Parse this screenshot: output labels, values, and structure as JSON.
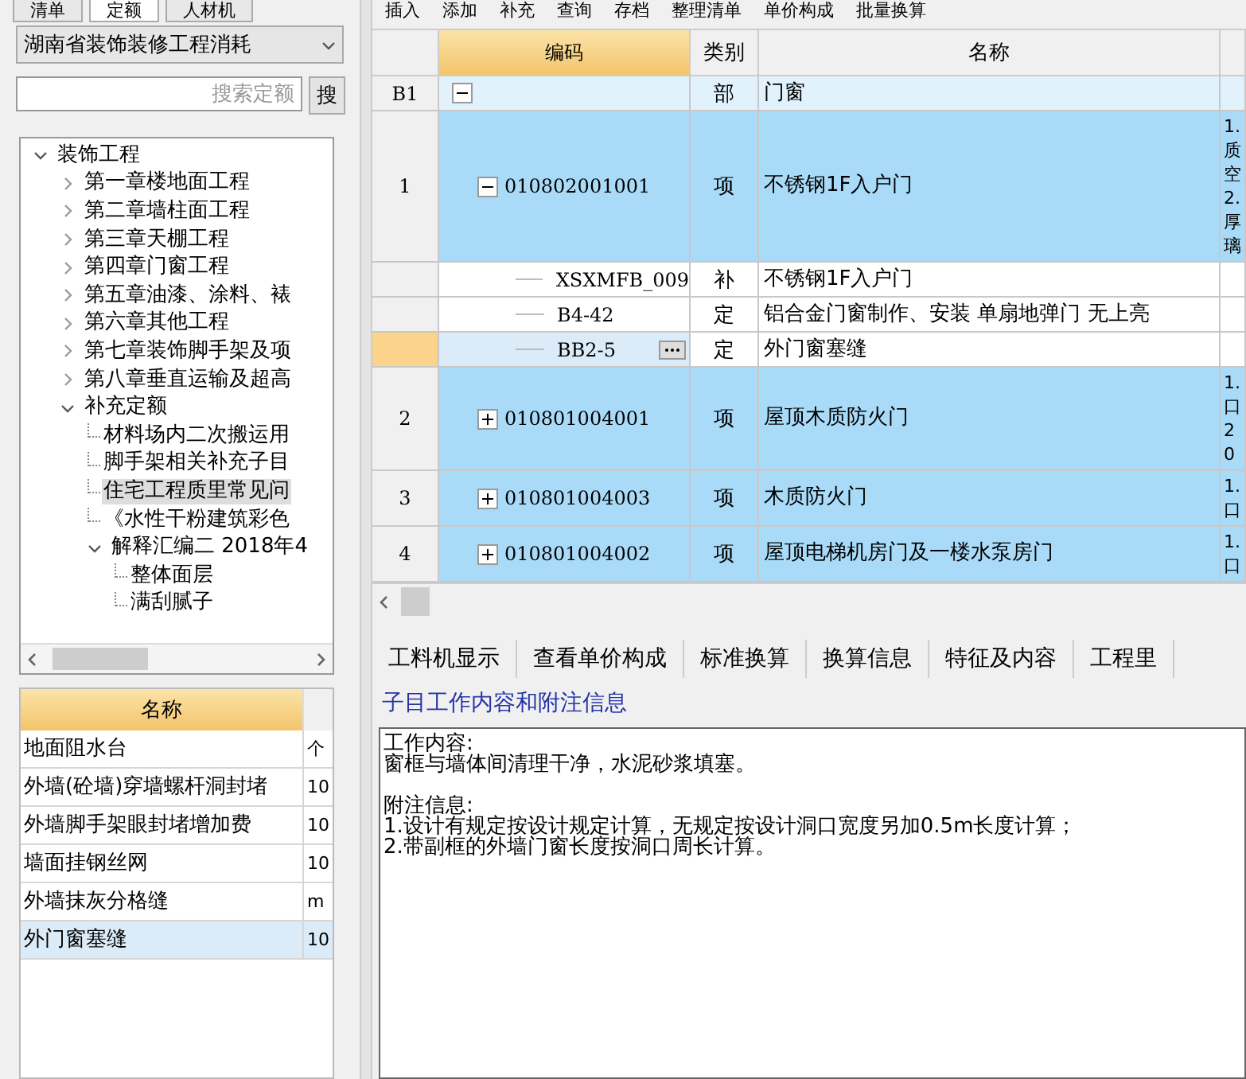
{
  "left_tabs": [
    {
      "label": "清单",
      "selected": false
    },
    {
      "label": "定额",
      "selected": true
    },
    {
      "label": "人材机",
      "selected": false
    }
  ],
  "library_dropdown": {
    "value": "湖南省装饰装修工程消耗"
  },
  "search": {
    "placeholder": "搜索定额",
    "button": "搜"
  },
  "tree": [
    {
      "label": "装饰工程",
      "expanded": true,
      "selected": false,
      "children": [
        {
          "label": "第一章楼地面工程",
          "expanded": false,
          "selected": false
        },
        {
          "label": "第二章墙柱面工程",
          "expanded": false,
          "selected": false
        },
        {
          "label": "第三章天棚工程",
          "expanded": false,
          "selected": false
        },
        {
          "label": "第四章门窗工程",
          "expanded": false,
          "selected": false
        },
        {
          "label": "第五章油漆、涂料、裱",
          "expanded": false,
          "selected": false
        },
        {
          "label": "第六章其他工程",
          "expanded": false,
          "selected": false
        },
        {
          "label": "第七章装饰脚手架及项",
          "expanded": false,
          "selected": false
        },
        {
          "label": "第八章垂直运输及超高",
          "expanded": false,
          "selected": false
        },
        {
          "label": "补充定额",
          "expanded": true,
          "selected": false,
          "children": [
            {
              "label": "材料场内二次搬运用",
              "selected": false
            },
            {
              "label": "脚手架相关补充子目",
              "selected": false
            },
            {
              "label": "住宅工程质里常见问",
              "selected": true
            },
            {
              "label": "《水性干粉建筑彩色",
              "selected": false
            },
            {
              "label": "解释汇编二 2018年4",
              "expanded": true,
              "selected": false,
              "children": [
                {
                  "label": "整体面层",
                  "selected": false
                },
                {
                  "label": "满刮腻子",
                  "selected": false
                }
              ]
            }
          ]
        }
      ]
    }
  ],
  "quota_table": {
    "columns": [
      "名称"
    ],
    "rows": [
      {
        "name": "地面阻水台",
        "unit": "个",
        "selected": false
      },
      {
        "name": "外墙(砼墙)穿墙螺杆洞封堵",
        "unit": "10",
        "selected": false
      },
      {
        "name": "外墙脚手架眼封堵增加费",
        "unit": "10",
        "selected": false
      },
      {
        "name": "墙面挂钢丝网",
        "unit": "10",
        "selected": false
      },
      {
        "name": "外墙抹灰分格缝",
        "unit": "m",
        "selected": false
      },
      {
        "name": "外门窗塞缝",
        "unit": "10",
        "selected": true
      }
    ]
  },
  "toolbar": [
    "插入",
    "添加",
    "补充",
    "查询",
    "存档",
    "整理清单",
    "单价构成",
    "批量换算"
  ],
  "grid": {
    "columns": [
      "编码",
      "类别",
      "名称"
    ],
    "rows": [
      {
        "row_number": "B1",
        "kind": "section",
        "expanded": true,
        "current": false,
        "type": "部",
        "name": "门窗"
      },
      {
        "row_number": "1",
        "kind": "item",
        "expanded": true,
        "current": false,
        "code": "010802001001",
        "type": "项",
        "name": "不锈钢1F入户门",
        "column_4": "1.质空2.厚璃"
      },
      {
        "kind": "quota",
        "current": false,
        "code": "XSXMFB_009",
        "type": "补",
        "name": "不锈钢1F入户门"
      },
      {
        "kind": "quota",
        "current": false,
        "code": "B4-42",
        "type": "定",
        "name": "铝合金门窗制作、安装 单扇地弹门 无上亮"
      },
      {
        "kind": "quota",
        "current": true,
        "code": "BB2-5",
        "type": "定",
        "name": "外门窗塞缝"
      },
      {
        "row_number": "2",
        "kind": "item",
        "expanded": false,
        "current": false,
        "code": "010801004001",
        "type": "项",
        "name": "屋顶木质防火门",
        "column_4": "1.口20"
      },
      {
        "row_number": "3",
        "kind": "item",
        "expanded": false,
        "current": false,
        "code": "010801004003",
        "type": "项",
        "name": "木质防火门",
        "column_4": "1.口"
      },
      {
        "row_number": "4",
        "kind": "item",
        "expanded": false,
        "current": false,
        "code": "010801004002",
        "type": "项",
        "name": "屋顶电梯机房门及一楼水泵房门",
        "column_4": "1.口"
      }
    ]
  },
  "bottom_tabs": [
    {
      "label": "工料机显示",
      "selected": false
    },
    {
      "label": "查看单价构成",
      "selected": false
    },
    {
      "label": "标准换算",
      "selected": false
    },
    {
      "label": "换算信息",
      "selected": false
    },
    {
      "label": "特征及内容",
      "selected": false
    },
    {
      "label": "工程里",
      "selected": false
    }
  ],
  "detail": {
    "heading": "子目工作内容和附注信息",
    "paragraphs": [
      [
        "工作内容:",
        "窗框与墙体间清理干净，水泥砂浆填塞。"
      ],
      [
        "附注信息:",
        "1.设计有规定按设计规定计算，无规定按设计洞口宽度另加0.5m长度计算；",
        "2.带副框的外墙门窗长度按洞口周长计算。"
      ]
    ]
  }
}
